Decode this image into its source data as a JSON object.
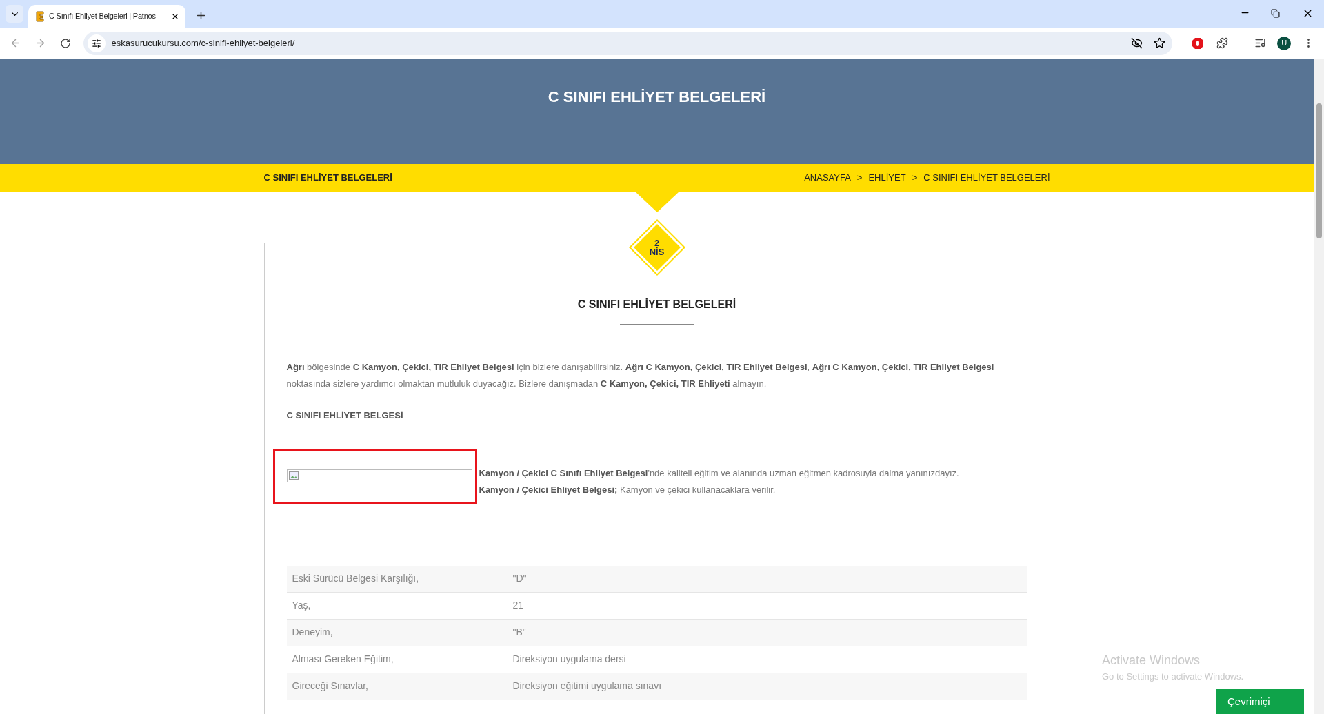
{
  "browser": {
    "tab_title": "C Sınıfı Ehliyet Belgeleri | Patnos",
    "url": "eskasurucukursu.com/c-sinifi-ehliyet-belgeleri/",
    "profile_initial": "U"
  },
  "header": {
    "title": "C SINIFI EHLİYET BELGELERİ"
  },
  "breadcrumb_bar": {
    "page_label": "C SINIFI EHLİYET BELGELERİ",
    "items": [
      {
        "label": "ANASAYFA"
      },
      {
        "separator": ">",
        "label": "EHLİYET"
      },
      {
        "separator": ">",
        "label": "C SINIFI EHLİYET BELGELERİ"
      }
    ]
  },
  "date_badge": {
    "day": "2",
    "month": "NİS"
  },
  "article": {
    "title": "C SINIFI EHLİYET BELGELERİ",
    "intro": "**Ağrı** bölgesinde **C Kamyon, Çekici, TIR Ehliyet Belgesi** için bizlere danışabilirsiniz. **Ağrı C Kamyon, Çekici, TIR Ehliyet Belgesi**, **Ağrı C Kamyon, Çekici, TIR Ehliyet Belgesi** noktasında sizlere yardımcı olmaktan mutluluk duyacağız. Bizlere danışmadan **C Kamyon, Çekici, TIR Ehliyeti** almayın.",
    "subheading": "C SINIFI EHLİYET BELGESİ",
    "image_text": "**Kamyon / Çekici C Sınıfı Ehliyet Belgesi**'nde kaliteli eğitim ve alanında uzman eğitmen kadrosuyla daima yanınızdayız. **Kamyon / Çekici Ehliyet Belgesi;** Kamyon ve çekici kullanacaklara verilir.",
    "table": {
      "rows": [
        {
          "label": "Eski Sürücü Belgesi Karşılığı,",
          "value": "\"D\""
        },
        {
          "label": "Yaş,",
          "value": "21"
        },
        {
          "label": "Deneyim,",
          "value": "\"B\""
        },
        {
          "label": "Alması Gereken Eğitim,",
          "value": "Direksiyon uygulama dersi"
        },
        {
          "label": "Gireceği Sınavlar,",
          "value": "Direksiyon eğitimi uygulama sınavı"
        }
      ]
    }
  },
  "windows_notice": {
    "title": "Activate Windows",
    "subtitle": "Go to Settings to activate Windows."
  },
  "chat_button": {
    "label": "Çevrimiçi"
  }
}
